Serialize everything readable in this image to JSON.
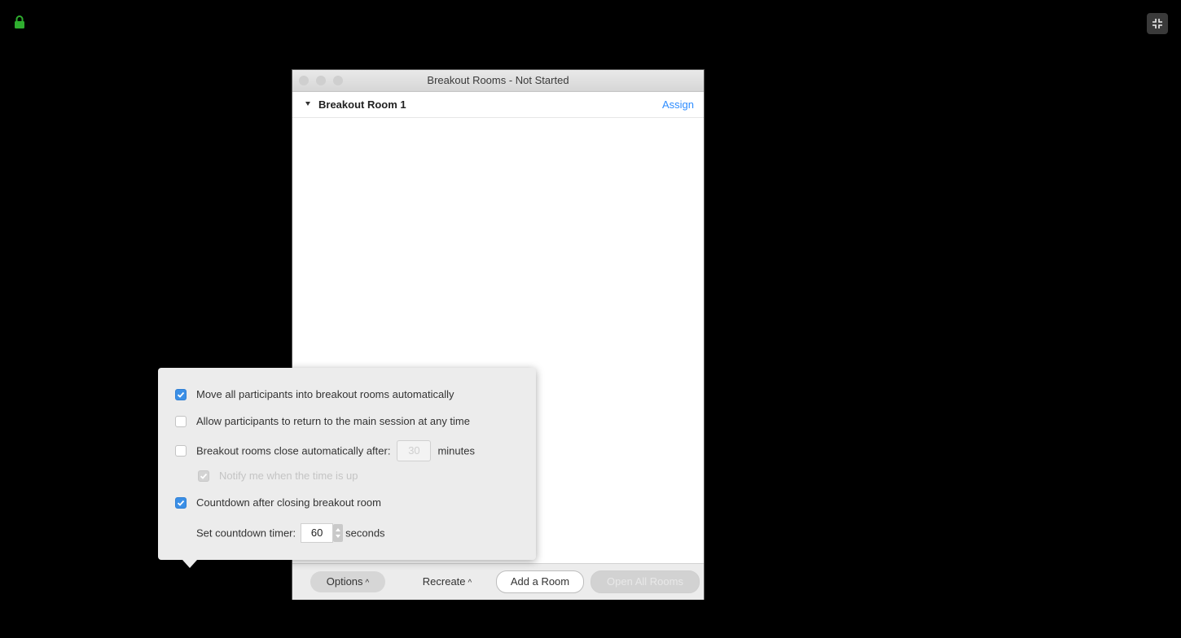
{
  "window": {
    "title": "Breakout Rooms - Not Started",
    "room": {
      "name": "Breakout Room 1",
      "assign_label": "Assign"
    }
  },
  "footer": {
    "options_label": "Options",
    "recreate_label": "Recreate",
    "add_room_label": "Add a Room",
    "open_all_label": "Open All Rooms",
    "caret": "^"
  },
  "options": {
    "move_all": {
      "label": "Move all participants into breakout rooms automatically",
      "checked": true
    },
    "allow_return": {
      "label": "Allow participants to return to the main session at any time",
      "checked": false
    },
    "auto_close": {
      "label": "Breakout rooms close automatically after:",
      "value": "30",
      "unit": "minutes",
      "checked": false
    },
    "notify": {
      "label": "Notify me when the time is up",
      "checked": true,
      "disabled": true
    },
    "countdown": {
      "label": "Countdown after closing breakout room",
      "checked": true
    },
    "countdown_timer": {
      "label": "Set countdown timer:",
      "value": "60",
      "unit": "seconds"
    }
  },
  "colors": {
    "accent": "#2d8cff",
    "checkbox": "#3b8fe6",
    "lock": "#2fae2f"
  }
}
